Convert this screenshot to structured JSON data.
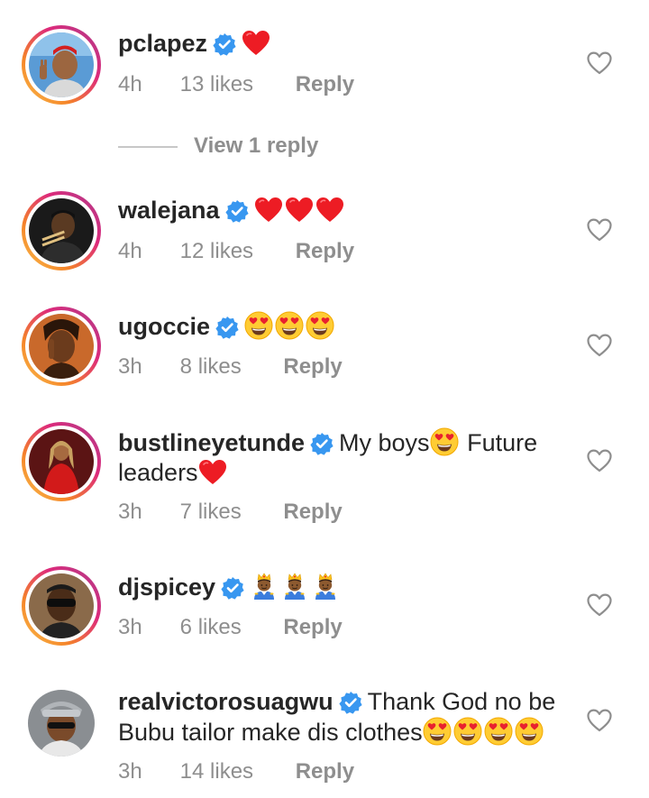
{
  "colors": {
    "text": "#262626",
    "meta": "#8e8e8e",
    "verified": "#3897f0",
    "heart_red": "#ed1c24",
    "divider": "#c7c7c7"
  },
  "comments": [
    {
      "username": "pclapez",
      "verified": true,
      "text": "",
      "emoji": [
        "red-heart"
      ],
      "time": "4h",
      "likes": "13 likes",
      "reply": "Reply",
      "story_ring": true,
      "view_replies": "View 1 reply"
    },
    {
      "username": "walejana",
      "verified": true,
      "text": "",
      "emoji": [
        "red-heart",
        "red-heart",
        "red-heart"
      ],
      "time": "4h",
      "likes": "12 likes",
      "reply": "Reply",
      "story_ring": true
    },
    {
      "username": "ugoccie",
      "verified": true,
      "text": "",
      "emoji": [
        "heart-eyes",
        "heart-eyes",
        "heart-eyes"
      ],
      "time": "3h",
      "likes": "8 likes",
      "reply": "Reply",
      "story_ring": true
    },
    {
      "username": "bustlineyetunde",
      "verified": true,
      "text_parts": [
        "My boys",
        "Future",
        "leaders"
      ],
      "emoji": [
        "heart-eyes",
        "red-heart"
      ],
      "time": "3h",
      "likes": "7 likes",
      "reply": "Reply",
      "story_ring": true
    },
    {
      "username": "djspicey",
      "verified": true,
      "text": "",
      "emoji": [
        "prince",
        "prince",
        "prince"
      ],
      "time": "3h",
      "likes": "6 likes",
      "reply": "Reply",
      "story_ring": true
    },
    {
      "username": "realvictorosuagwu",
      "verified": true,
      "text_parts": [
        "Thank God no be",
        "Bubu tailor make dis clothes"
      ],
      "emoji": [
        "heart-eyes",
        "heart-eyes",
        "heart-eyes",
        "heart-eyes"
      ],
      "time": "3h",
      "likes": "14 likes",
      "reply": "Reply",
      "story_ring": false
    }
  ]
}
